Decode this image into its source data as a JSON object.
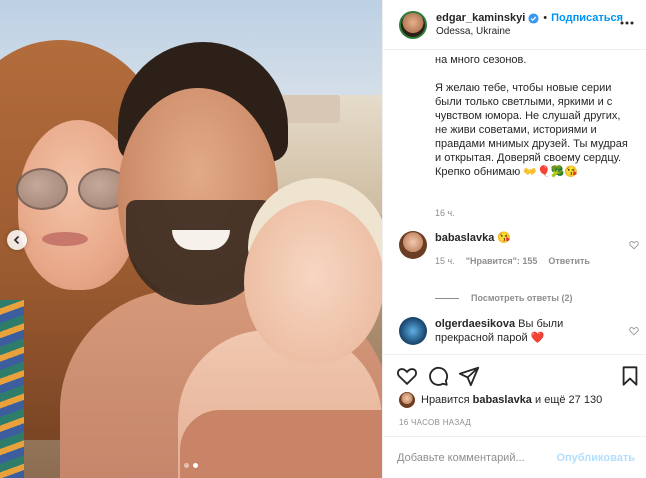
{
  "post": {
    "username": "edgar_kaminskyi",
    "follow_label": "Подписаться",
    "location": "Odessa, Ukraine",
    "caption_lines": [
      "на много сезонов.",
      "Я желаю тебе, чтобы новые серии были только светлыми, яркими и с чувством юмора. Не слушай других, не живи советами, историями и правдами мнимых друзей. Ты мудрая и открытая. Доверяй своему сердцу. Крепко обнимаю 👐🎈🥦😘"
    ],
    "caption_time": "16 ч.",
    "likes_prefix": "Нравится",
    "likes_user": "babaslavka",
    "likes_suffix": "и ещё 27 130",
    "post_time": "16 ЧАСОВ НАЗАД",
    "comment_placeholder": "Добавьте комментарий...",
    "publish_label": "Опубликовать",
    "carousel_slide": 2,
    "carousel_total": 2
  },
  "comments": [
    {
      "user": "babaslavka",
      "text": "😘",
      "time": "15 ч.",
      "likes": "\"Нравится\": 155",
      "reply": "Ответить"
    },
    {
      "user": "olgerdaesikova",
      "text": "Вы были прекрасной парой ❤️"
    }
  ],
  "replies_label": "Посмотреть ответы (2)",
  "colors": {
    "accent": "#0095f6",
    "verified": "#3897f0",
    "publish_disabled": "#b2dffc"
  }
}
